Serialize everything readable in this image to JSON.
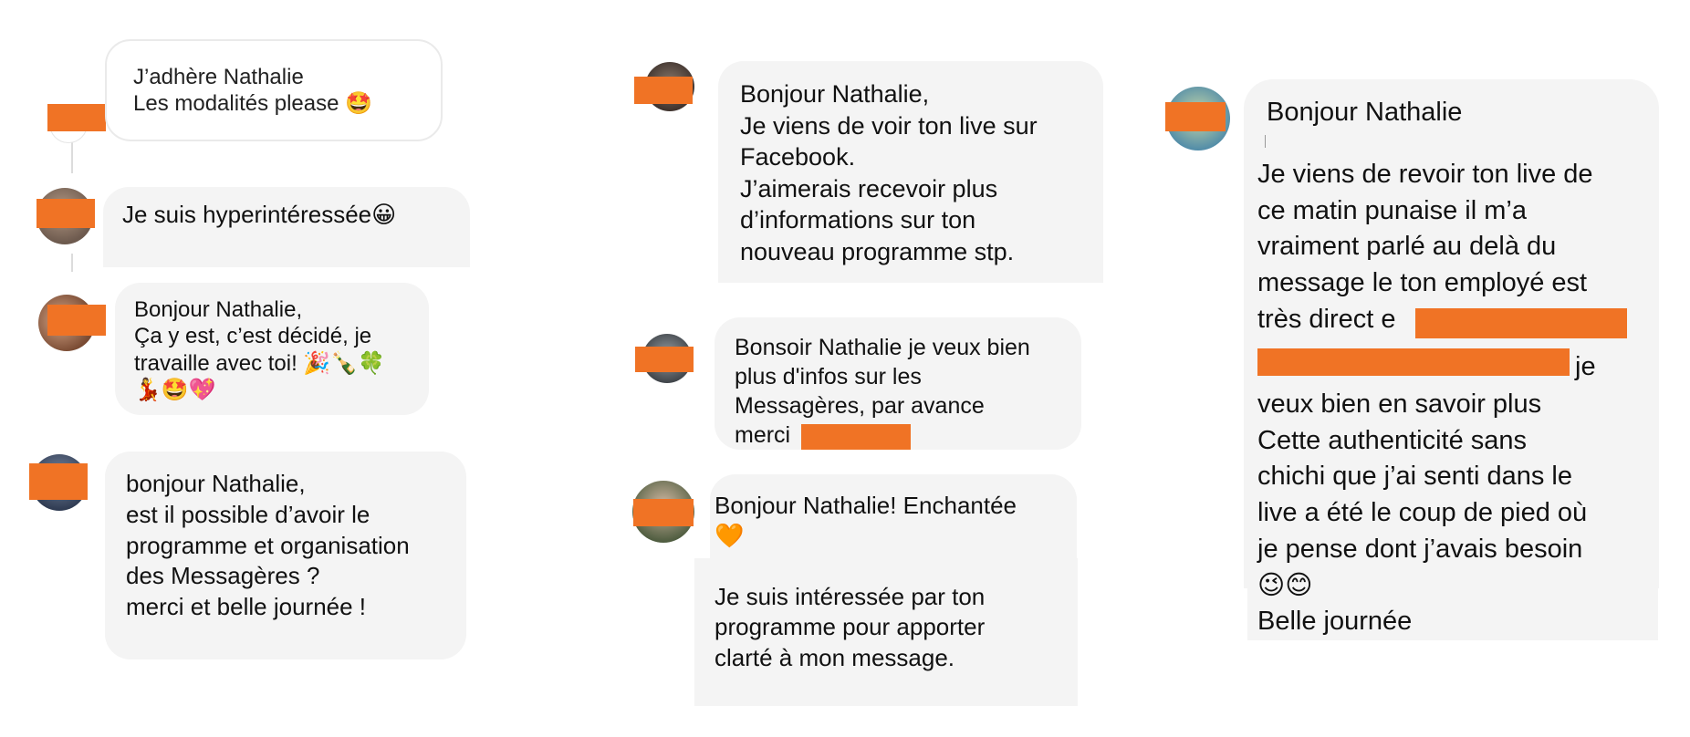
{
  "colors": {
    "bubble_bg": "#f4f4f4",
    "redaction": "#f07325",
    "page_bg": "#ffffff"
  },
  "messages": [
    {
      "id": "m1",
      "text": "J’adhère Nathalie\nLes modalités please 🤩"
    },
    {
      "id": "m2",
      "text": "Je suis hyperintéressée😀"
    },
    {
      "id": "m3",
      "text": "Bonjour Nathalie,\nÇa y est, c’est décidé, je\ntravaille avec toi! 🎉🍾🍀\n💃🤩💖"
    },
    {
      "id": "m4",
      "text": "bonjour Nathalie,\nest il possible d’avoir le\nprogramme et organisation\ndes Messagères ?\nmerci et belle journée !"
    },
    {
      "id": "m5",
      "text": "Bonjour Nathalie,\nJe viens de voir ton live sur\nFacebook.\nJ’aimerais recevoir plus\nd’informations sur ton\nnouveau programme stp."
    },
    {
      "id": "m6",
      "text": "Bonsoir Nathalie je veux bien\nplus d'infos sur les\nMessagères, par avance\nmerci"
    },
    {
      "id": "m7",
      "text": "Bonjour Nathalie! Enchantée\n🧡"
    },
    {
      "id": "m8",
      "text": "Je suis intéressée par ton\nprogramme pour apporter\nclarté à mon message."
    },
    {
      "id": "m9_greeting",
      "text": "Bonjour Nathalie"
    },
    {
      "id": "m9_body_a",
      "text": "Je viens de revoir ton live de\nce matin punaise il m’a\nvraiment parlé au delà du\nmessage le ton employé est\ntrès direct e"
    },
    {
      "id": "m9_body_b",
      "text": "je"
    },
    {
      "id": "m9_body_c",
      "text": "veux bien en savoir plus\nCette authenticité sans\nchichi que j’ai senti dans le\nlive a été le coup de pied où\nje pense dont j’avais besoin\n😉😊\nBelle journée"
    }
  ],
  "icons": {
    "avatars": [
      "user-avatar-icon"
    ],
    "redactions": [
      "redaction-bar"
    ]
  }
}
